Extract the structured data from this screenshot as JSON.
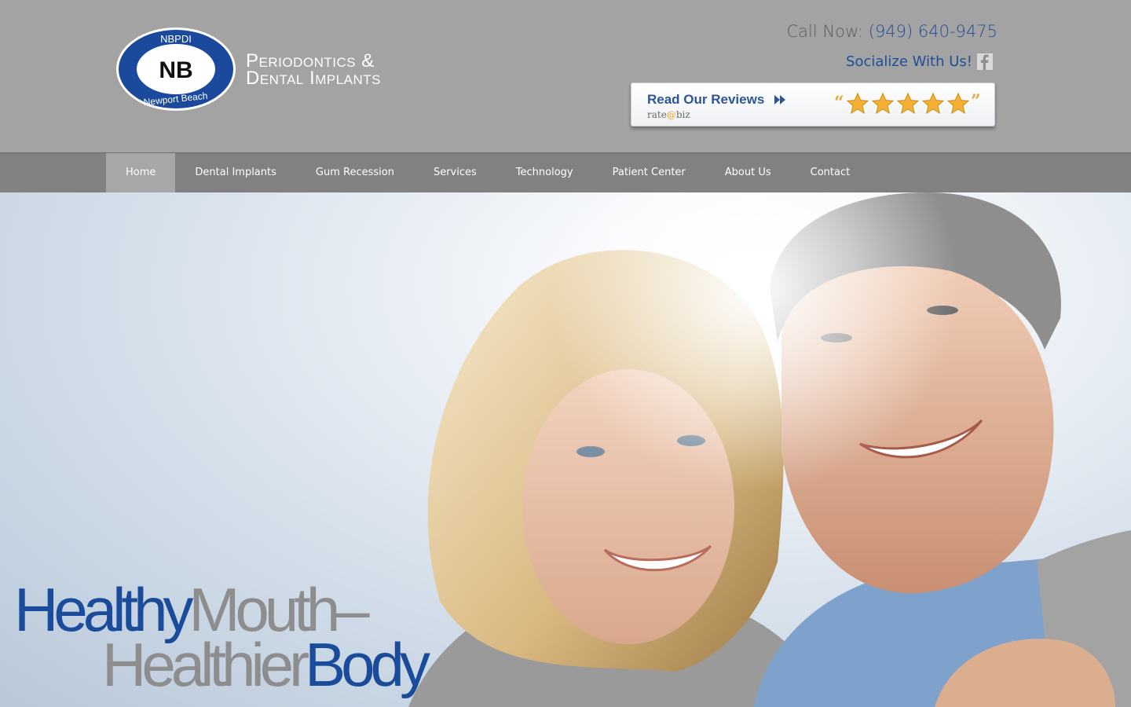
{
  "header": {
    "logo": {
      "badge_top": "NBPDI",
      "badge_center": "NB",
      "badge_bottom": "Newport Beach",
      "line1": "Periodontics &",
      "line2": "Dental Implants"
    },
    "call_label": "Call Now:",
    "phone": "(949) 640-9475",
    "social_label": "Socialize With Us!",
    "reviews": {
      "label": "Read Our Reviews",
      "brand_prefix": "rate",
      "brand_at": "@",
      "brand_suffix": "biz",
      "stars": 5
    }
  },
  "nav": {
    "items": [
      {
        "label": "Home"
      },
      {
        "label": "Dental Implants"
      },
      {
        "label": "Gum Recession"
      },
      {
        "label": "Services"
      },
      {
        "label": "Technology"
      },
      {
        "label": "Patient Center"
      },
      {
        "label": "About Us"
      },
      {
        "label": "Contact"
      }
    ],
    "active_index": 0
  },
  "hero": {
    "tagline": {
      "w1": "Healthy",
      "w2": "Mouth",
      "dash": "–",
      "w3": "Healthier",
      "w4": "Body"
    }
  },
  "colors": {
    "header_bg": "#a3a3a3",
    "nav_bg": "#818181",
    "nav_active_bg": "#a7a7a7",
    "brand_blue": "#1f4e96",
    "star_gold": "#f2b134"
  }
}
